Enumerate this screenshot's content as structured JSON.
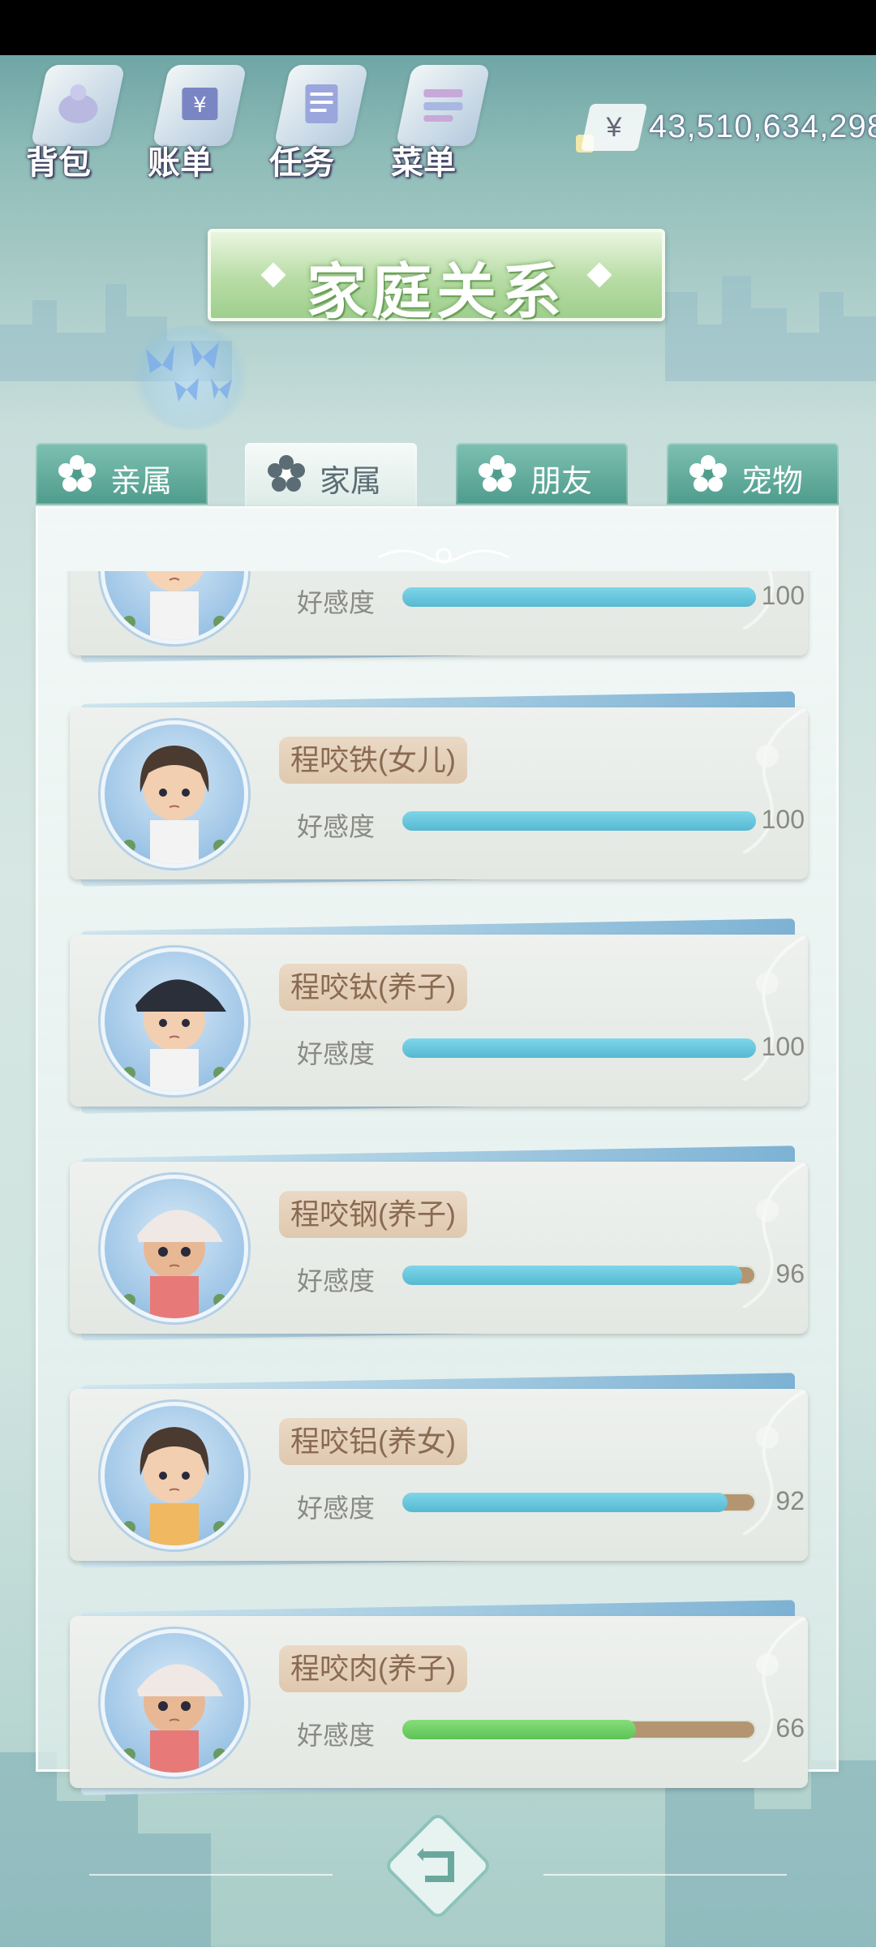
{
  "topnav": {
    "items": [
      {
        "label": "背包",
        "icon": "bag-icon"
      },
      {
        "label": "账单",
        "icon": "bill-icon"
      },
      {
        "label": "任务",
        "icon": "task-icon"
      },
      {
        "label": "菜单",
        "icon": "menu-icon"
      }
    ]
  },
  "money": {
    "symbol": "¥",
    "value": "43,510,634,298"
  },
  "title": "家庭关系",
  "tabs": [
    {
      "label": "亲属",
      "active": false
    },
    {
      "label": "家属",
      "active": true
    },
    {
      "label": "朋友",
      "active": false
    },
    {
      "label": "宠物",
      "active": false
    }
  ],
  "affection_label": "好感度",
  "members": [
    {
      "name": "",
      "affection": 100
    },
    {
      "name": "程咬铁(女儿)",
      "affection": 100
    },
    {
      "name": "程咬钛(养子)",
      "affection": 100
    },
    {
      "name": "程咬钢(养子)",
      "affection": 96
    },
    {
      "name": "程咬铝(养女)",
      "affection": 92
    },
    {
      "name": "程咬肉(养子)",
      "affection": 66
    }
  ],
  "colors": {
    "bar_fill_high": "#56b9d2",
    "bar_fill_low": "#5cc356",
    "bar_track": "#b49572",
    "tab_inactive": "#4f9c8c",
    "title_plate": "#9fcf8e"
  }
}
